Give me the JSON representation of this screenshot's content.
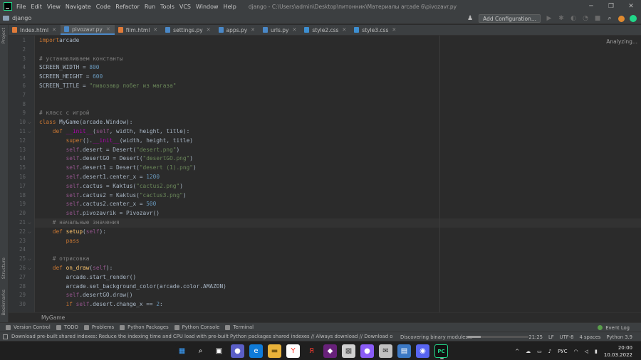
{
  "titlebar": {
    "menu": [
      "File",
      "Edit",
      "View",
      "Navigate",
      "Code",
      "Refactor",
      "Run",
      "Tools",
      "VCS",
      "Window",
      "Help"
    ],
    "window_title": "django - C:\\Users\\admin\\Desktop\\питонник\\Материалы arcade 6\\pivozavr.py",
    "minimize": "─",
    "maximize": "❐",
    "close": "✕"
  },
  "navbar": {
    "project": "django",
    "add_config": "Add Configuration..."
  },
  "tabs": [
    {
      "label": "Index.html",
      "color": "#e07b39",
      "active": false
    },
    {
      "label": "pivozavr.py",
      "color": "#4a88c7",
      "active": true
    },
    {
      "label": "film.html",
      "color": "#e07b39",
      "active": false
    },
    {
      "label": "settings.py",
      "color": "#4a88c7",
      "active": false
    },
    {
      "label": "apps.py",
      "color": "#4a88c7",
      "active": false
    },
    {
      "label": "urls.py",
      "color": "#4a88c7",
      "active": false
    },
    {
      "label": "style2.css",
      "color": "#3d8fd1",
      "active": false
    },
    {
      "label": "style3.css",
      "color": "#3d8fd1",
      "active": false
    }
  ],
  "left_strip": {
    "project": "Project",
    "structure": "Structure",
    "bookmarks": "Bookmarks"
  },
  "editor": {
    "analyzing": "Analyzing...",
    "caret_line": 21,
    "lines": [
      [
        [
          "kw",
          "import"
        ],
        [
          "",
          "arcade"
        ]
      ],
      [],
      [
        [
          "cmt",
          "# устанавливаем константы"
        ]
      ],
      [
        [
          "",
          "SCREEN_WIDTH = "
        ],
        [
          "num",
          "800"
        ]
      ],
      [
        [
          "",
          "SCREEN_HEIGHT = "
        ],
        [
          "num",
          "600"
        ]
      ],
      [
        [
          "",
          "SCREEN_TITLE = "
        ],
        [
          "str",
          "\"пивозавр побег из магаза\""
        ]
      ],
      [],
      [],
      [
        [
          "cmt",
          "# класс с игрой"
        ]
      ],
      [
        [
          "kw",
          "class "
        ],
        [
          "cls",
          "MyGame(arcade.Window):"
        ]
      ],
      [
        [
          "",
          "    "
        ],
        [
          "kw",
          "def "
        ],
        [
          "dunder",
          "__init__"
        ],
        [
          "",
          "("
        ],
        [
          "self",
          "self"
        ],
        [
          "",
          ", width, height, title):"
        ]
      ],
      [
        [
          "",
          "        "
        ],
        [
          "kw",
          "super"
        ],
        [
          "",
          "()."
        ],
        [
          "dunder",
          "__init__"
        ],
        [
          "",
          "(width, height, title)"
        ]
      ],
      [
        [
          "",
          "        "
        ],
        [
          "self",
          "self"
        ],
        [
          "",
          ".desert = Desert("
        ],
        [
          "str",
          "\"desert.png\""
        ],
        [
          "",
          ")"
        ]
      ],
      [
        [
          "",
          "        "
        ],
        [
          "self",
          "self"
        ],
        [
          "",
          ".desertGO = Desert("
        ],
        [
          "str",
          "\"desertGO.png\""
        ],
        [
          "",
          ")"
        ]
      ],
      [
        [
          "",
          "        "
        ],
        [
          "self",
          "self"
        ],
        [
          "",
          ".desert1 = Desert("
        ],
        [
          "str",
          "\"desert (1).png\""
        ],
        [
          "",
          ")"
        ]
      ],
      [
        [
          "",
          "        "
        ],
        [
          "self",
          "self"
        ],
        [
          "",
          ".desert1.center_x = "
        ],
        [
          "num",
          "1200"
        ]
      ],
      [
        [
          "",
          "        "
        ],
        [
          "self",
          "self"
        ],
        [
          "",
          ".cactus = Kaktus("
        ],
        [
          "str",
          "\"cactus2.png\""
        ],
        [
          "",
          ")"
        ]
      ],
      [
        [
          "",
          "        "
        ],
        [
          "self",
          "self"
        ],
        [
          "",
          ".cactus2 = Kaktus("
        ],
        [
          "str",
          "\"cactus3.png\""
        ],
        [
          "",
          ")"
        ]
      ],
      [
        [
          "",
          "        "
        ],
        [
          "self",
          "self"
        ],
        [
          "",
          ".cactus2.center_x = "
        ],
        [
          "num",
          "500"
        ]
      ],
      [
        [
          "",
          "        "
        ],
        [
          "self",
          "self"
        ],
        [
          "",
          ".pivozavrik = Pivozavr()"
        ]
      ],
      [
        [
          "",
          "    "
        ],
        [
          "cmt",
          "# начальные значения"
        ]
      ],
      [
        [
          "",
          "    "
        ],
        [
          "kw",
          "def "
        ],
        [
          "fn",
          "setup"
        ],
        [
          "",
          "("
        ],
        [
          "self",
          "self"
        ],
        [
          "",
          "):"
        ]
      ],
      [
        [
          "",
          "        "
        ],
        [
          "kw",
          "pass"
        ]
      ],
      [],
      [
        [
          "",
          "    "
        ],
        [
          "cmt",
          "# отрисовка"
        ]
      ],
      [
        [
          "",
          "    "
        ],
        [
          "kw",
          "def "
        ],
        [
          "fn",
          "on_draw"
        ],
        [
          "",
          "("
        ],
        [
          "self",
          "self"
        ],
        [
          "",
          "):"
        ]
      ],
      [
        [
          "",
          "        arcade.start_render()"
        ]
      ],
      [
        [
          "",
          "        arcade.set_background_color(arcade.color.AMAZON)"
        ]
      ],
      [
        [
          "",
          "        "
        ],
        [
          "self",
          "self"
        ],
        [
          "",
          ".desertGO.draw()"
        ]
      ],
      [
        [
          "",
          "        "
        ],
        [
          "kw",
          "if "
        ],
        [
          "self",
          "self"
        ],
        [
          "",
          ".desert.change_x == "
        ],
        [
          "num",
          "2"
        ],
        [
          "",
          ":"
        ]
      ]
    ]
  },
  "breadcrumb": "MyGame",
  "toolwindows": [
    "Version Control",
    "TODO",
    "Problems",
    "Python Packages",
    "Python Console",
    "Terminal"
  ],
  "event_log": "Event Log",
  "status": {
    "message": "Download pre-built shared indexes: Reduce the indexing time and CPU load with pre-built Python packages shared indexes // Always download // Download once // Don't ...",
    "bg_task": "Discovering binary modules...",
    "progress": 0.22,
    "right": [
      "21:25",
      "LF",
      "UTF-8",
      "4 spaces",
      "Python 3.9"
    ]
  },
  "taskbar": {
    "icons": [
      {
        "name": "windows-start-icon",
        "glyph": "▦",
        "bg": "#1f1f1f",
        "fg": "#3aa0ff",
        "running": false
      },
      {
        "name": "search-icon",
        "glyph": "⌕",
        "bg": "#1f1f1f",
        "fg": "#ffffff",
        "running": false
      },
      {
        "name": "task-view-icon",
        "glyph": "▣",
        "bg": "#1f1f1f",
        "fg": "#ffffff",
        "running": false
      },
      {
        "name": "chat-icon",
        "glyph": "●",
        "bg": "#5b5fc7",
        "fg": "#ffffff",
        "running": false
      },
      {
        "name": "edge-icon",
        "glyph": "e",
        "bg": "#0f7bd8",
        "fg": "#ffffff",
        "running": false
      },
      {
        "name": "explorer-icon",
        "glyph": "▬",
        "bg": "#e8b23a",
        "fg": "#7a5a12",
        "running": false
      },
      {
        "name": "yandex-icon",
        "glyph": "Y",
        "bg": "#ffffff",
        "fg": "#ff2e1f",
        "running": false
      },
      {
        "name": "yandex-browser-icon",
        "glyph": "Я",
        "bg": "#1f1f1f",
        "fg": "#ff3b30",
        "running": false
      },
      {
        "name": "visual-studio-icon",
        "glyph": "◆",
        "bg": "#68217a",
        "fg": "#ffffff",
        "running": false
      },
      {
        "name": "photos-icon",
        "glyph": "▩",
        "bg": "#d0d0d0",
        "fg": "#555555",
        "running": false
      },
      {
        "name": "app-purple-icon",
        "glyph": "●",
        "bg": "#8a5cf6",
        "fg": "#ffffff",
        "running": false
      },
      {
        "name": "mail-icon",
        "glyph": "✉",
        "bg": "#c0c0c0",
        "fg": "#333333",
        "running": false
      },
      {
        "name": "store-icon",
        "glyph": "▤",
        "bg": "#3b78c4",
        "fg": "#ffffff",
        "running": false
      },
      {
        "name": "discord-icon",
        "glyph": "◉",
        "bg": "#5865f2",
        "fg": "#ffffff",
        "running": false
      },
      {
        "name": "pycharm-icon",
        "glyph": "PC",
        "bg": "#111111",
        "fg": "#21d789",
        "running": true
      }
    ],
    "tray": {
      "chevron": "^",
      "lang": "РУС",
      "time": "20:00",
      "date": "10.03.2022"
    }
  }
}
